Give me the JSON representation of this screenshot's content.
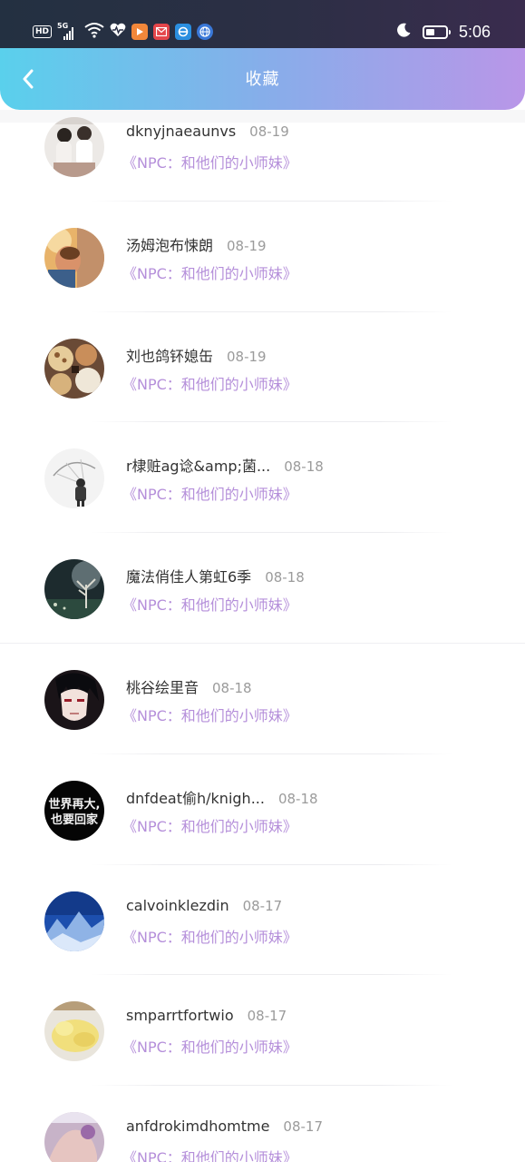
{
  "status_bar": {
    "hd": "HD",
    "network": "5G",
    "time": "5:06",
    "battery_level": 0.45
  },
  "nav": {
    "title": "收藏",
    "back_icon": "chevron-left-icon"
  },
  "colors": {
    "nav_gradient_start": "#5ad0ec",
    "nav_gradient_end": "#b996e8",
    "accent_purple": "#b58fda",
    "name_text": "#333333",
    "date_text": "#9b9b9b"
  },
  "favorites": [
    {
      "name": "dknyjnaeaunvs",
      "date": "08-19",
      "book": "《NPC：和他们的小师妹》",
      "avatar": "two-girls-photo"
    },
    {
      "name": "汤姆泡布悚朗",
      "date": "08-19",
      "book": "《NPC：和他们的小师妹》",
      "avatar": "warm-portrait-photo"
    },
    {
      "name": "刘也鸽钚媳缶",
      "date": "08-19",
      "book": "《NPC：和他们的小师妹》",
      "avatar": "food-photo"
    },
    {
      "name": "r棣赃ag谂&amp;菌...",
      "date": "08-18",
      "book": "《NPC：和他们的小师妹》",
      "avatar": "umbrella-sketch"
    },
    {
      "name": "魔法俏佳人第虹6季",
      "date": "08-18",
      "book": "《NPC：和他们的小师妹》",
      "avatar": "night-tree-photo"
    },
    {
      "name": "桃谷绘里音",
      "date": "08-18",
      "book": "《NPC：和他们的小师妹》",
      "avatar": "anime-boy"
    },
    {
      "name": "dnfdeat偷h/knigh...",
      "date": "08-18",
      "book": "《NPC：和他们的小师妹》",
      "avatar": "text-poster",
      "avatar_text_1": "世界再大,",
      "avatar_text_2": "也要回家"
    },
    {
      "name": "calvoinklezdin",
      "date": "08-17",
      "book": "《NPC：和他们的小师妹》",
      "avatar": "blue-mountain"
    },
    {
      "name": "smparrtfortwio",
      "date": "08-17",
      "book": "《NPC：和他们的小师妹》",
      "avatar": "banana-bread"
    },
    {
      "name": "anfdrokimdhomtme",
      "date": "08-17",
      "book": "《NPC：和他们的小师妹》",
      "avatar": "hand-photo"
    }
  ]
}
